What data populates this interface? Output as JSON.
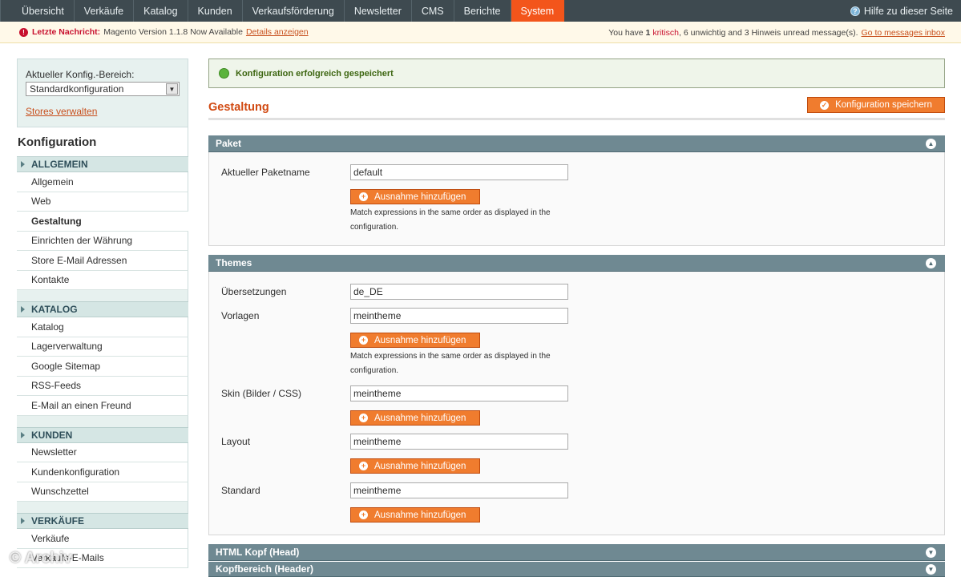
{
  "nav": {
    "items": [
      "Übersicht",
      "Verkäufe",
      "Katalog",
      "Kunden",
      "Verkaufsförderung",
      "Newsletter",
      "CMS",
      "Berichte",
      "System"
    ],
    "active": "System",
    "help": "Hilfe zu dieser Seite"
  },
  "notification": {
    "label": "Letzte Nachricht:",
    "text": "Magento Version 1.1.8 Now Available",
    "link": "Details anzeigen",
    "right_prefix": "You have",
    "critical_count": "1",
    "critical_label": "kritisch",
    "minor": ", 6 unwichtig and 3 Hinweis unread message(s).",
    "inbox_link": "Go to messages inbox"
  },
  "sidebar": {
    "scope_label": "Aktueller Konfig.-Bereich:",
    "scope_value": "Standardkonfiguration",
    "stores_link": "Stores verwalten",
    "title": "Konfiguration",
    "sections": [
      {
        "head": "ALLGEMEIN",
        "items": [
          "Allgemein",
          "Web",
          "Gestaltung",
          "Einrichten der Währung",
          "Store E-Mail Adressen",
          "Kontakte"
        ]
      },
      {
        "head": "KATALOG",
        "items": [
          "Katalog",
          "Lagerverwaltung",
          "Google Sitemap",
          "RSS-Feeds",
          "E-Mail an einen Freund"
        ]
      },
      {
        "head": "KUNDEN",
        "items": [
          "Newsletter",
          "Kundenkonfiguration",
          "Wunschzettel"
        ]
      },
      {
        "head": "VERKÄUFE",
        "items": [
          "Verkäufe",
          "Verkaufs-E-Mails"
        ]
      }
    ],
    "active_item": "Gestaltung"
  },
  "main": {
    "success": "Konfiguration erfolgreich gespeichert",
    "title": "Gestaltung",
    "save_button": "Konfiguration speichern",
    "add_button": "Ausnahme hinzufügen",
    "note_line1": "Match expressions in the same order as displayed in the",
    "note_line2": "configuration.",
    "paket": {
      "head": "Paket",
      "label": "Aktueller Paketname",
      "value": "default"
    },
    "themes": {
      "head": "Themes",
      "rows": [
        {
          "label": "Übersetzungen",
          "value": "de_DE"
        },
        {
          "label": "Vorlagen",
          "value": "meintheme"
        },
        {
          "label": "Skin (Bilder / CSS)",
          "value": "meintheme"
        },
        {
          "label": "Layout",
          "value": "meintheme"
        },
        {
          "label": "Standard",
          "value": "meintheme"
        }
      ]
    },
    "collapsed_sections": [
      "HTML Kopf (Head)",
      "Kopfbereich (Header)"
    ]
  },
  "watermark": "© Archiv",
  "colors": {
    "accent": "#f3551b",
    "nav_bg": "#3e4a50",
    "fieldset_head": "#6f8992"
  }
}
